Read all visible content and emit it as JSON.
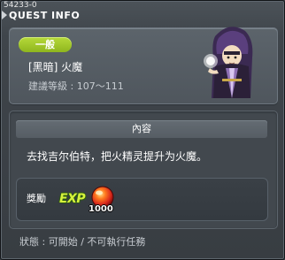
{
  "window": {
    "quest_id": "54233-0",
    "title": "QUEST INFO"
  },
  "quest": {
    "badge": "一般",
    "name": "[黑暗] 火魔",
    "level_requirement": "建議等級 : 107～111"
  },
  "content": {
    "header": "內容",
    "description": "去找吉尔伯特，把火精灵提升为火魔。"
  },
  "reward": {
    "label": "獎勵",
    "exp_label": "EXP",
    "exp_amount": "1000"
  },
  "status": {
    "text": "狀態 : 可開始 / 不可執行任務"
  },
  "colors": {
    "badge_green": "#9fc62a",
    "window_bg": "#3f454b",
    "exp_green": "#d6f23c",
    "orb_red": "#d8281c"
  },
  "icons": [
    "close-icon",
    "npc-wizard-portrait",
    "exp-icon",
    "fire-orb-icon"
  ]
}
